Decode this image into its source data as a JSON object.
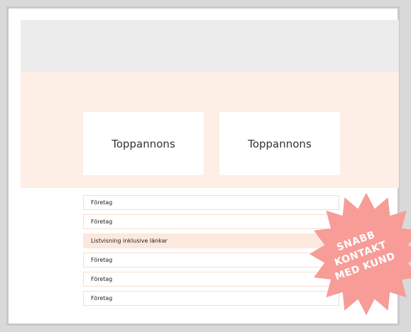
{
  "ads": {
    "left_label": "Toppannons",
    "right_label": "Toppannons"
  },
  "list": {
    "items": [
      {
        "label": "Företag",
        "highlight": false
      },
      {
        "label": "Företag",
        "highlight": false
      },
      {
        "label": "Listvisning inklusive länkar",
        "highlight": true
      },
      {
        "label": "Företag",
        "highlight": false
      },
      {
        "label": "Företag",
        "highlight": false
      },
      {
        "label": "Företag",
        "highlight": false
      }
    ]
  },
  "badge": {
    "line1": "SNABB",
    "line2": "KONTAKT",
    "line3": "MED KUND",
    "color": "#f79c97"
  },
  "colors": {
    "page_bg": "#d9d9d9",
    "header_gray": "#ececec",
    "peach": "#fdeee6",
    "row_highlight": "#fde8dd"
  }
}
